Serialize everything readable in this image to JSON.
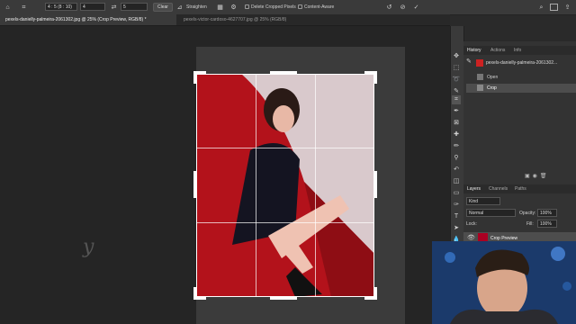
{
  "options_bar": {
    "ratio_value": "4 : 5 (8 : 10)",
    "width_value": "4",
    "height_value": "5",
    "clear_label": "Clear",
    "straighten_label": "Straighten",
    "delete_cropped_label": "Delete Cropped Pixels",
    "content_aware_label": "Content-Aware"
  },
  "tabs": [
    {
      "label": "pexels-danielly-palmeira-2061302.jpg @ 25% (Crop Preview, RGB/8) *",
      "active": true
    },
    {
      "label": "pexels-victor-cardoso-4627707.jpg @ 25% (RGB/8)",
      "active": false
    }
  ],
  "history_panel": {
    "tabs": [
      "History",
      "Actions",
      "Info"
    ],
    "snapshot_label": "pexels-danielly-palmeira-2061302...",
    "items": [
      "Open",
      "Crop"
    ]
  },
  "layers_panel": {
    "tabs": [
      "Layers",
      "Channels",
      "Paths"
    ],
    "kind_label": "Kind",
    "blend_mode": "Normal",
    "opacity_label": "Opacity:",
    "opacity_value": "100%",
    "lock_label": "Lock:",
    "fill_label": "Fill:",
    "fill_value": "100%",
    "layer_name": "Crop Preview"
  },
  "canvas_cursor_glyph": "y",
  "colors": {
    "accent": "#1473e6",
    "photo_red": "#b3121b"
  }
}
